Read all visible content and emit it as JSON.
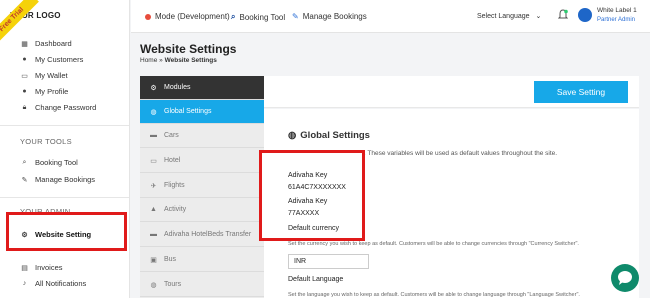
{
  "sidebar": {
    "logo": "YOUR LOGO",
    "ribbon": "Free Trial",
    "items": [
      {
        "label": "Dashboard",
        "icon": "dashboard-icon"
      },
      {
        "label": "My Customers",
        "icon": "user-icon"
      },
      {
        "label": "My Wallet",
        "icon": "wallet-icon"
      },
      {
        "label": "My Profile",
        "icon": "user-icon"
      },
      {
        "label": "Change Password",
        "icon": "lock-icon"
      }
    ],
    "tools_heading": "YOUR TOOLS",
    "tools": [
      {
        "label": "Booking Tool",
        "icon": "search-icon"
      },
      {
        "label": "Manage Bookings",
        "icon": "edit-icon"
      }
    ],
    "admin_heading": "YOUR ADMIN",
    "admin": [
      {
        "label": "Website Setting",
        "icon": "gear-icon"
      },
      {
        "label": "Invoices",
        "icon": "invoice-icon"
      },
      {
        "label": "All Notifications",
        "icon": "bell-icon"
      }
    ]
  },
  "topbar": {
    "mode": "Mode (Development)",
    "booking_tool": "Booking Tool",
    "manage_bookings": "Manage Bookings",
    "language": "Select Language",
    "user_name": "White Label 1",
    "user_role": "Partner Admin"
  },
  "page": {
    "title": "Website Settings",
    "breadcrumb_home": "Home",
    "breadcrumb_sep": "»",
    "breadcrumb_current": "Website Settings"
  },
  "settings_menu": [
    {
      "label": "Modules",
      "icon": "gear-icon"
    },
    {
      "label": "Global Settings",
      "icon": "globe-icon"
    },
    {
      "label": "Cars",
      "icon": "car-icon"
    },
    {
      "label": "Hotel",
      "icon": "bed-icon"
    },
    {
      "label": "Flights",
      "icon": "plane-icon"
    },
    {
      "label": "Activity",
      "icon": "activity-icon"
    },
    {
      "label": "Adivaha HotelBeds Transfer",
      "icon": "car-icon"
    },
    {
      "label": "Bus",
      "icon": "bus-icon"
    },
    {
      "label": "Tours",
      "icon": "globe-icon"
    }
  ],
  "content": {
    "save_label": "Save Setting",
    "section_title": "Global Settings",
    "section_desc": "variables will be used as default values throughout the site.",
    "desc_prefix": "Set all the global variables. These",
    "adivaha_key_label": "Adivaha Key",
    "adivaha_key_value": "61A4C7XXXXXXX",
    "adivaha_key2_label": "Adivaha Key",
    "adivaha_key2_value": "77AXXXX",
    "currency_label": "Default currency",
    "currency_help": "Set the currency you wish to keep as default. Customers will be able to change currencies through \"Currency Switcher\".",
    "currency_value": "INR",
    "language_label": "Default Language",
    "language_help": "Set the language you wish to keep as default. Customers will be able to change language through \"Language Switcher\"."
  },
  "colors": {
    "accent": "#17a8e8",
    "highlight": "#e01a1a",
    "ribbon": "#f5d20a",
    "menu_dark": "#333333",
    "chat": "#0f8a6b"
  }
}
